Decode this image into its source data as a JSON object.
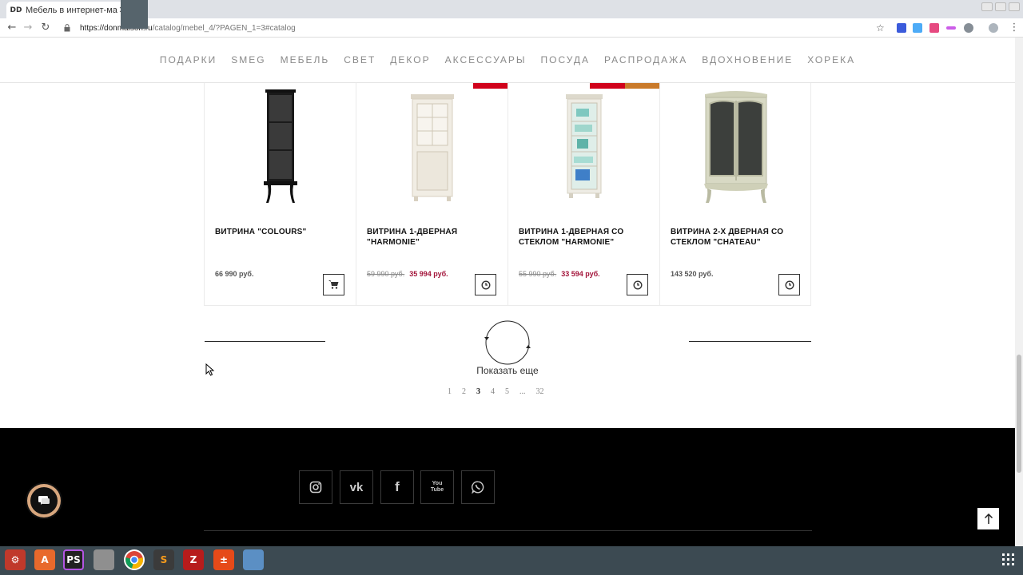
{
  "browser": {
    "tab_title": "Мебель в интернет-мага",
    "favicon_text": "DD",
    "url_host": "https://donmaison.ru",
    "url_path": "/catalog/mebel_4/?PAGEN_1=3#catalog",
    "new_tab_label": "+",
    "tab_close_label": "✕"
  },
  "nav": {
    "items": [
      "ПОДАРКИ",
      "SMEG",
      "МЕБЕЛЬ",
      "СВЕТ",
      "ДЕКОР",
      "АКСЕССУАРЫ",
      "ПОСУДА",
      "РАСПРОДАЖА",
      "ВДОХНОВЕНИЕ",
      "ХОРЕКА"
    ]
  },
  "products": [
    {
      "name": "ВИТРИНА \"COLOURS\"",
      "price": "66 990 руб.",
      "old_price": "",
      "new_price": "",
      "action_icon": "cart-icon",
      "cabinet_color": "#1a1a1a"
    },
    {
      "name": "ВИТРИНА 1-ДВЕРНАЯ \"HARMONIE\"",
      "price": "",
      "old_price": "59 990 руб.",
      "new_price": "35 994 руб.",
      "action_icon": "clock-icon",
      "cabinet_color": "#f1ede4"
    },
    {
      "name": "ВИТРИНА 1-ДВЕРНАЯ СО СТЕКЛОМ \"HARMONIE\"",
      "price": "",
      "old_price": "55 990 руб.",
      "new_price": "33 594 руб.",
      "action_icon": "clock-icon",
      "cabinet_color": "#eeece4"
    },
    {
      "name": "ВИТРИНА 2-Х ДВЕРНАЯ СО СТЕКЛОМ \"CHATEAU\"",
      "price": "143 520 руб.",
      "old_price": "",
      "new_price": "",
      "action_icon": "clock-icon",
      "cabinet_color": "#d8d9c4"
    }
  ],
  "load_more": {
    "label": "Показать еще"
  },
  "pagination": {
    "pages": [
      "1",
      "2",
      "3",
      "4",
      "5",
      "...",
      "32"
    ],
    "current": "3"
  },
  "footer": {
    "social_icons": [
      "instagram-icon",
      "vk-icon",
      "facebook-icon",
      "youtube-icon",
      "whatsapp-icon"
    ],
    "vk_text": "vk",
    "facebook_text": "f",
    "youtube_text": "You\nTube"
  },
  "colors": {
    "accent_red": "#d0021b",
    "accent_orange": "#c97a2a",
    "sale_price": "#a3143a",
    "footer_bg": "#000000",
    "chat_ring": "#d8a77e"
  }
}
